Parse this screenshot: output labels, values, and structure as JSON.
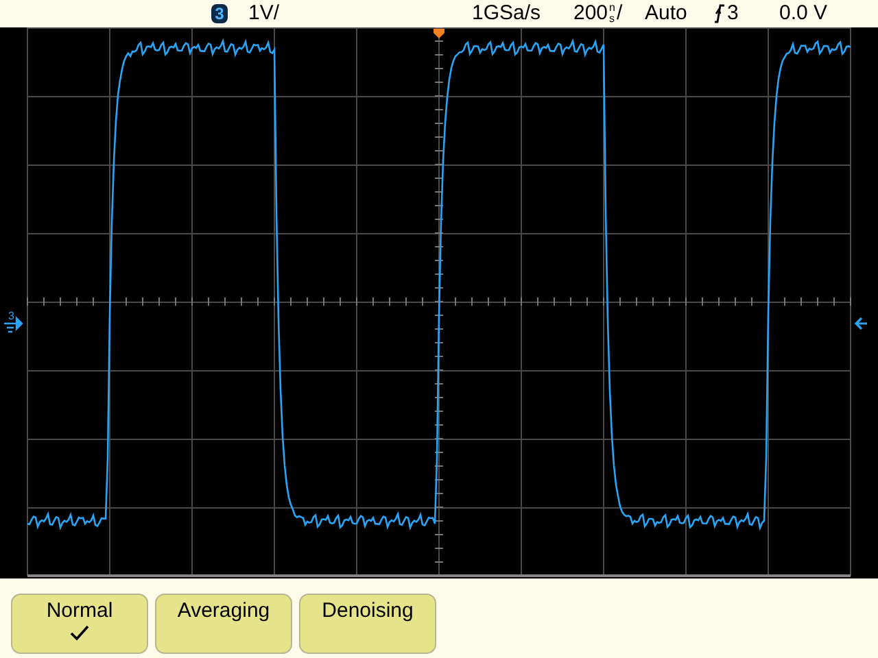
{
  "status_bar": {
    "channel": "3",
    "scale": "1V/",
    "sample_rate": "1GSa/s",
    "timebase": {
      "value": "200",
      "unit_top": "n",
      "unit_bottom": "s",
      "suffix": "/"
    },
    "trigger_mode": "Auto",
    "trigger_source": "3",
    "offset": "0.0 V"
  },
  "channel_marker": "3",
  "softkeys": [
    {
      "label": "Normal",
      "selected": true
    },
    {
      "label": "Averaging",
      "selected": false
    },
    {
      "label": "Denoising",
      "selected": false
    }
  ]
}
